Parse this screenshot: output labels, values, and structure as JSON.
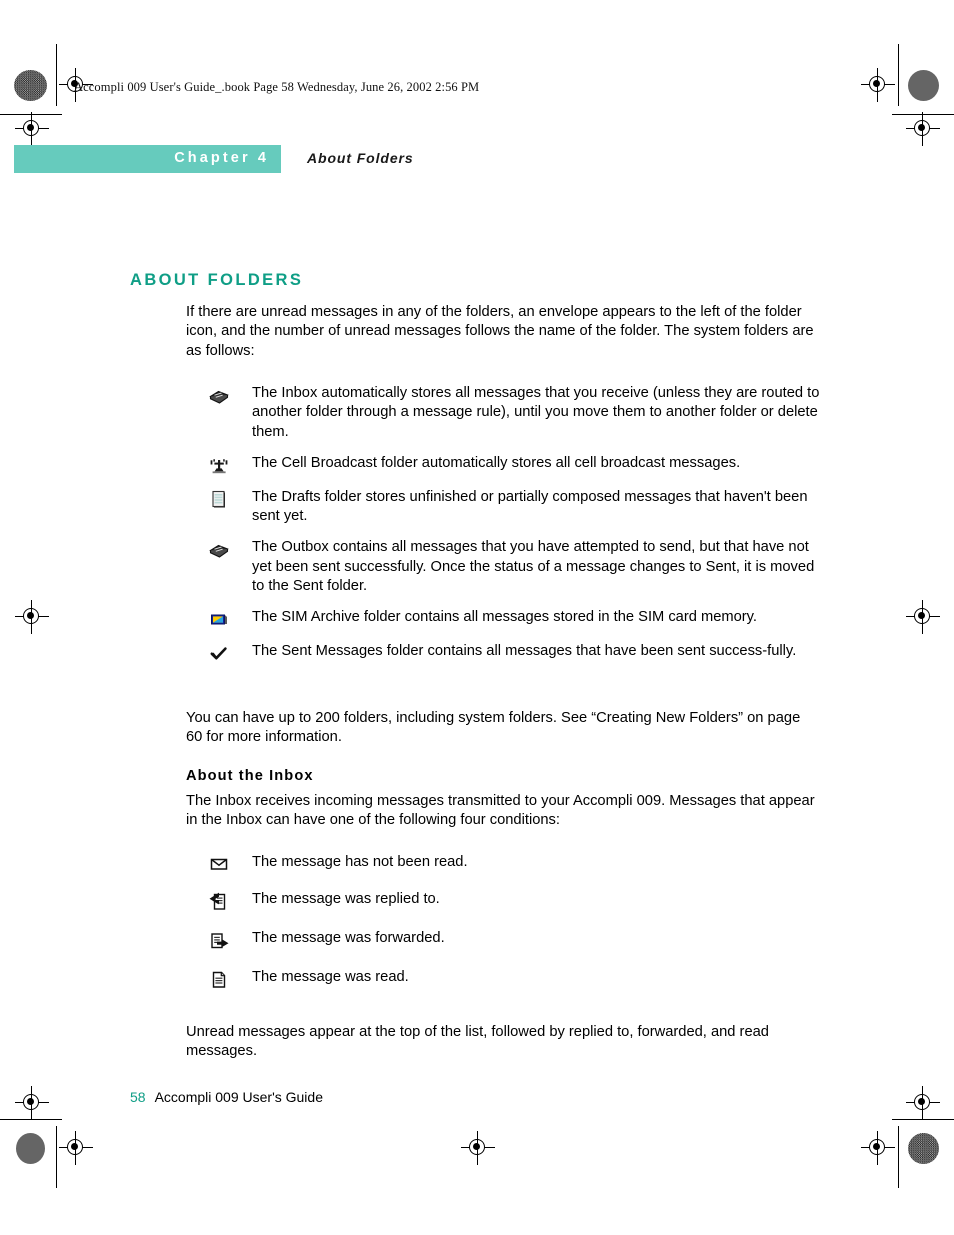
{
  "page": {
    "slug": "Accompli 009 User's Guide_.book  Page 58  Wednesday, June 26, 2002  2:56 PM",
    "chapter_label": "Chapter 4",
    "chapter_topic": "About Folders",
    "banner_color": "#66cbbd",
    "accent_color": "#0f9e86"
  },
  "section": {
    "title": "ABOUT FOLDERS",
    "intro": "If there are unread messages in any of the folders, an envelope appears to the left of the folder icon, and the number of unread messages follows the name of the folder. The system folders are as follows:",
    "folders": [
      {
        "icon": "inbox-tray-icon",
        "text": "The Inbox automatically stores all messages that you receive (unless they are routed to another folder through a message rule), until you move them to another folder or delete them."
      },
      {
        "icon": "broadcast-tower-icon",
        "text": "The Cell Broadcast folder automatically stores all cell broadcast messages."
      },
      {
        "icon": "draft-document-icon",
        "text": "The Drafts folder stores unfinished or partially composed messages that haven't been sent yet."
      },
      {
        "icon": "outbox-tray-icon",
        "text": "The Outbox contains all messages that you have attempted to send, but that have not yet been sent successfully. Once the status of a message changes to Sent, it is moved to the Sent folder."
      },
      {
        "icon": "sim-card-icon",
        "text": "The SIM Archive folder contains all messages stored in the SIM card memory."
      },
      {
        "icon": "checkmark-icon",
        "text": "The Sent Messages folder contains all messages that have been sent success-fully."
      }
    ],
    "folder_limit_note": "You can have up to 200 folders, including system folders. See “Creating New Folders” on page 60 for more information."
  },
  "inbox_section": {
    "subhead": "About the Inbox",
    "intro": "The Inbox receives incoming messages transmitted to your Accompli 009. Messages that appear in the Inbox can have one of the following four conditions:",
    "conditions": [
      {
        "icon": "envelope-icon",
        "text": "The message has not been read."
      },
      {
        "icon": "reply-arrow-icon",
        "text": "The message was replied to."
      },
      {
        "icon": "forward-arrow-icon",
        "text": "The message was forwarded."
      },
      {
        "icon": "read-document-icon",
        "text": "The message was read."
      }
    ],
    "sort_note": "Unread messages appear at the top of the list, followed by replied to, forwarded, and read messages."
  },
  "footer": {
    "page_number": "58",
    "book_name": "Accompli 009 User's Guide"
  }
}
